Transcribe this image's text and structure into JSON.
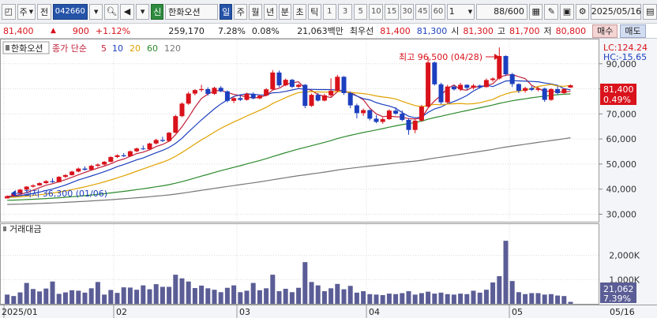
{
  "toolbar": {
    "type_select": "주",
    "jeon_label": "전",
    "stock_code": "042660",
    "stock_name": "한화오션",
    "credit_badge": "신",
    "periods": [
      "일",
      "주",
      "월",
      "년",
      "분",
      "초",
      "틱"
    ],
    "active_period": "일",
    "intervals": [
      "1",
      "3",
      "5",
      "10",
      "15",
      "30",
      "45",
      "60"
    ],
    "unit_value": "1",
    "bar_count": "88/600",
    "date": "2025/05/16"
  },
  "info": {
    "price": "81,400",
    "change_arrow": "▲",
    "change": "900",
    "change_pct": "+1.12%",
    "volume": "259,170",
    "turnover_pct": "7.28%",
    "ratio": "0.08%",
    "amount": "21,063백만",
    "best_ask_label": "최우선",
    "best_ask": "81,400",
    "best_bid": "81,300",
    "open_label": "시",
    "open": "81,300",
    "high_label": "고",
    "high": "81,700",
    "low_label": "저",
    "low": "80,800",
    "buy_button": "매수",
    "sell_button": "매도"
  },
  "legend": {
    "name": "한화오션",
    "ma_label": "종가 단순",
    "ma_periods": [
      "5",
      "10",
      "20",
      "60",
      "120"
    ],
    "ma_colors": [
      "#c0203a",
      "#1c3fbf",
      "#e0a200",
      "#2c8a2c",
      "#777777"
    ],
    "lc": "LC:124.24",
    "hc": "HC:-15.65",
    "volume_title": "거래대금"
  },
  "price_axis": {
    "ticks": [
      "90,000",
      "80,000",
      "70,000",
      "60,000",
      "50,000",
      "40,000",
      "30,000"
    ],
    "current_label": "81,400",
    "current_pct": "0.49%"
  },
  "volume_axis": {
    "ticks": [
      "2,000K",
      "1,000K"
    ],
    "current_label": "21,062",
    "current_pct": "7.39%"
  },
  "annotations": {
    "high": "최고 96,500 (04/28)",
    "low": "최저 36,300 (01/06)"
  },
  "x_axis": {
    "labels": [
      "2025/01",
      "02",
      "03",
      "04",
      "05"
    ],
    "end_label": "05/16"
  },
  "colors": {
    "up": "#d9121b",
    "down": "#1c3fbf",
    "volume": "#5b5d96"
  },
  "chart_data": {
    "type": "candlestick",
    "y_range": [
      27000,
      100000
    ],
    "candles": [
      [
        36300,
        37500,
        36300,
        37200
      ],
      [
        37200,
        38500,
        37000,
        38200
      ],
      [
        38200,
        40100,
        38000,
        39800
      ],
      [
        39800,
        41200,
        39500,
        41000
      ],
      [
        41000,
        41900,
        40600,
        41500
      ],
      [
        41500,
        42700,
        41300,
        42400
      ],
      [
        42400,
        43600,
        42100,
        43200
      ],
      [
        43200,
        44300,
        42500,
        42800
      ],
      [
        42800,
        45200,
        42600,
        44900
      ],
      [
        44900,
        46000,
        44400,
        45600
      ],
      [
        45600,
        47300,
        45400,
        47000
      ],
      [
        47000,
        48600,
        46700,
        48200
      ],
      [
        48200,
        49100,
        47400,
        47700
      ],
      [
        47700,
        49700,
        47500,
        49300
      ],
      [
        49300,
        50300,
        48800,
        49800
      ],
      [
        49800,
        51200,
        49400,
        50900
      ],
      [
        50900,
        53100,
        50600,
        52800
      ],
      [
        52800,
        53900,
        52400,
        53500
      ],
      [
        53500,
        54400,
        52800,
        53100
      ],
      [
        53100,
        55400,
        52900,
        55100
      ],
      [
        55100,
        56600,
        54700,
        56200
      ],
      [
        56200,
        57400,
        55600,
        55900
      ],
      [
        55900,
        58500,
        55600,
        58200
      ],
      [
        58200,
        60100,
        57800,
        59600
      ],
      [
        59600,
        60900,
        58800,
        59200
      ],
      [
        59200,
        62800,
        58900,
        62500
      ],
      [
        62500,
        69600,
        62300,
        69100
      ],
      [
        69100,
        74600,
        68700,
        74100
      ],
      [
        74100,
        78800,
        73600,
        78100
      ],
      [
        78100,
        79900,
        77400,
        79500
      ],
      [
        79500,
        81600,
        78800,
        79900
      ],
      [
        79900,
        80600,
        77300,
        78000
      ],
      [
        78000,
        80800,
        77600,
        80400
      ],
      [
        80400,
        81100,
        78600,
        79000
      ],
      [
        79000,
        79400,
        74600,
        75200
      ],
      [
        75200,
        76900,
        74300,
        76300
      ],
      [
        76300,
        77800,
        75100,
        75600
      ],
      [
        75600,
        78500,
        75300,
        78000
      ],
      [
        78000,
        78600,
        75800,
        76200
      ],
      [
        76200,
        77600,
        75800,
        77300
      ],
      [
        77300,
        80300,
        77000,
        79800
      ],
      [
        79800,
        87500,
        79400,
        86500
      ],
      [
        86500,
        87300,
        80700,
        81400
      ],
      [
        81400,
        84100,
        81000,
        83600
      ],
      [
        83600,
        84000,
        80300,
        80800
      ],
      [
        80800,
        82100,
        80300,
        81600
      ],
      [
        81600,
        81900,
        72300,
        73200
      ],
      [
        73200,
        78100,
        72800,
        77600
      ],
      [
        77600,
        78300,
        74900,
        75300
      ],
      [
        75300,
        78000,
        75000,
        77400
      ],
      [
        77400,
        84200,
        76800,
        79200
      ],
      [
        79200,
        85600,
        78600,
        84800
      ],
      [
        84800,
        85100,
        77600,
        78300
      ],
      [
        78300,
        78900,
        72300,
        73400
      ],
      [
        73400,
        74100,
        68200,
        70300
      ],
      [
        70300,
        72100,
        69200,
        71500
      ],
      [
        71500,
        71800,
        67400,
        68100
      ],
      [
        68100,
        69500,
        66300,
        66800
      ],
      [
        66800,
        68600,
        66100,
        67900
      ],
      [
        67900,
        71800,
        67600,
        71300
      ],
      [
        71300,
        72600,
        69600,
        70100
      ],
      [
        70100,
        71400,
        67100,
        67600
      ],
      [
        67600,
        68300,
        61700,
        63600
      ],
      [
        63600,
        68200,
        62300,
        67300
      ],
      [
        67300,
        73600,
        66900,
        72900
      ],
      [
        72900,
        92800,
        72600,
        90500
      ],
      [
        90500,
        90900,
        81300,
        81800
      ],
      [
        81800,
        82400,
        73800,
        74600
      ],
      [
        74600,
        81600,
        74200,
        80900
      ],
      [
        80900,
        81600,
        79300,
        79800
      ],
      [
        79800,
        82400,
        79100,
        81600
      ],
      [
        81600,
        81800,
        79600,
        80400
      ],
      [
        80400,
        81900,
        79700,
        81300
      ],
      [
        81300,
        81700,
        80200,
        80700
      ],
      [
        80700,
        84100,
        80500,
        83500
      ],
      [
        83500,
        84600,
        82800,
        84100
      ],
      [
        84100,
        96500,
        83700,
        93100
      ],
      [
        93100,
        93300,
        85100,
        85800
      ],
      [
        85800,
        86400,
        80700,
        81900
      ],
      [
        81900,
        82200,
        78300,
        79200
      ],
      [
        79200,
        80800,
        78500,
        80300
      ],
      [
        80300,
        81100,
        79100,
        79600
      ],
      [
        79600,
        80700,
        79000,
        80100
      ],
      [
        80100,
        80500,
        74800,
        75600
      ],
      [
        75600,
        80300,
        75200,
        79900
      ],
      [
        79900,
        81000,
        77600,
        78300
      ],
      [
        78300,
        80300,
        77800,
        79900
      ],
      [
        80500,
        81700,
        80400,
        81400
      ]
    ],
    "volume": [
      380,
      320,
      470,
      860,
      610,
      510,
      630,
      920,
      410,
      470,
      560,
      540,
      460,
      640,
      900,
      380,
      570,
      450,
      680,
      670,
      580,
      760,
      600,
      810,
      700,
      700,
      1200,
      1050,
      920,
      650,
      750,
      640,
      580,
      480,
      660,
      760,
      480,
      540,
      860,
      560,
      640,
      1200,
      520,
      620,
      480,
      660,
      1720,
      900,
      760,
      520,
      640,
      820,
      600,
      740,
      460,
      520,
      400,
      380,
      360,
      420,
      400,
      440,
      520,
      380,
      440,
      500,
      420,
      460,
      400,
      380,
      420,
      400,
      540,
      460,
      580,
      880,
      1140,
      2600,
      940,
      480,
      400,
      440,
      440,
      380,
      400,
      340,
      320,
      80
    ]
  }
}
